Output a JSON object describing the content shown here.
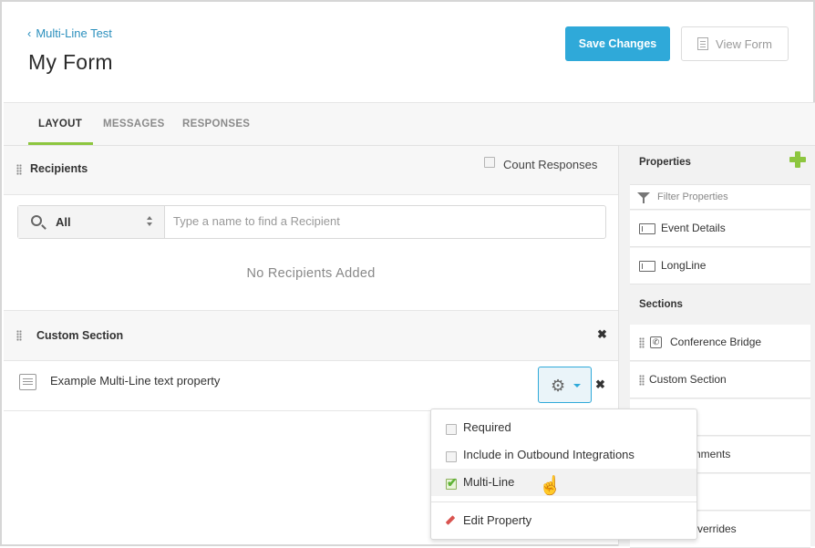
{
  "header": {
    "back_label": "Multi-Line Test",
    "title": "My Form",
    "save_label": "Save Changes",
    "view_label": "View Form"
  },
  "tabs": [
    {
      "label": "LAYOUT",
      "active": true
    },
    {
      "label": "MESSAGES",
      "active": false
    },
    {
      "label": "RESPONSES",
      "active": false
    }
  ],
  "recipients": {
    "title": "Recipients",
    "count_label": "Count Responses",
    "filter_value": "All",
    "search_placeholder": "Type a name to find a Recipient",
    "empty_text": "No Recipients Added"
  },
  "custom_section": {
    "title": "Custom Section",
    "property_label": "Example Multi-Line text property"
  },
  "dropdown": {
    "required_label": "Required",
    "outbound_label": "Include in Outbound Integrations",
    "multiline_label": "Multi-Line",
    "multiline_checked": true,
    "edit_label": "Edit Property"
  },
  "right_panel": {
    "properties_title": "Properties",
    "filter_placeholder": "Filter Properties",
    "properties": [
      "Event Details",
      "LongLine"
    ],
    "sections_title": "Sections",
    "sections": [
      "Conference Bridge",
      "Custom Section"
    ],
    "partial_items": [
      "hments",
      "verrides"
    ]
  },
  "colors": {
    "accent": "#2fa9d9",
    "tab_underline": "#8dc63f",
    "add_icon": "#8dc63f"
  }
}
